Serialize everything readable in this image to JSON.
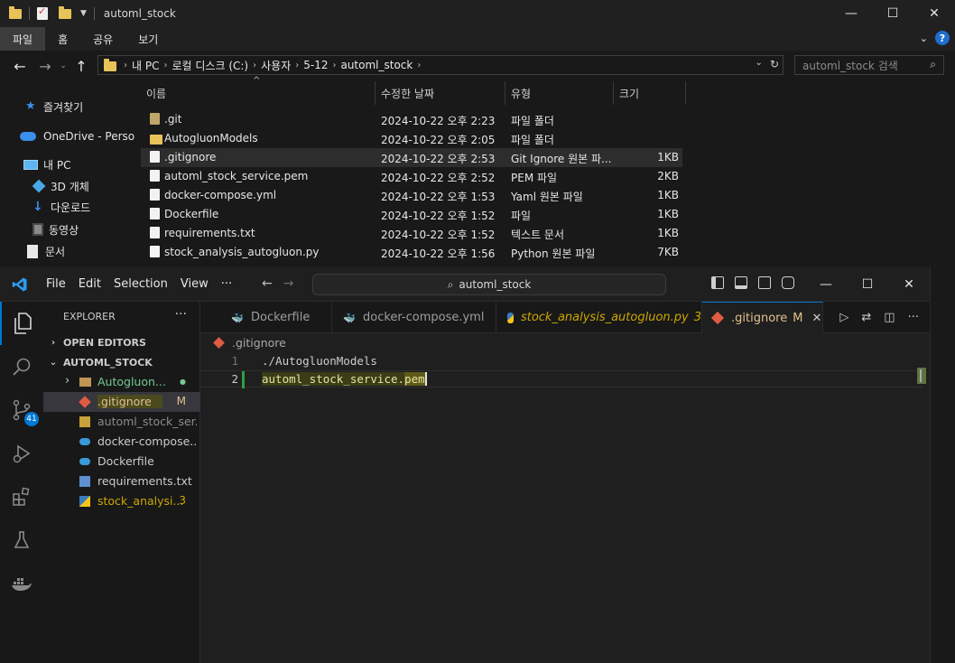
{
  "explorer": {
    "title": "automl_stock",
    "ribbon_tabs": [
      "파일",
      "홈",
      "공유",
      "보기"
    ],
    "address": [
      "내 PC",
      "로컬 디스크 (C:)",
      "사용자",
      "5-12",
      "automl_stock"
    ],
    "search_placeholder": "automl_stock 검색",
    "nav_items": [
      {
        "label": "즐겨찾기",
        "icon": "star-icon"
      },
      {
        "label": "OneDrive - Perso",
        "icon": "cloud-icon"
      },
      {
        "label": "내 PC",
        "icon": "pc-icon"
      },
      {
        "label": "3D 개체",
        "icon": "cube-icon"
      },
      {
        "label": "다운로드",
        "icon": "download-icon"
      },
      {
        "label": "동영상",
        "icon": "video-icon"
      },
      {
        "label": "문서",
        "icon": "document-icon"
      }
    ],
    "columns": [
      "이름",
      "수정한 날짜",
      "유형",
      "크기"
    ],
    "files": [
      {
        "name": ".git",
        "date": "2024-10-22 오후 2:23",
        "type": "파일 폴더",
        "size": "",
        "kind": "git"
      },
      {
        "name": "AutogluonModels",
        "date": "2024-10-22 오후 2:05",
        "type": "파일 폴더",
        "size": "",
        "kind": "folder"
      },
      {
        "name": ".gitignore",
        "date": "2024-10-22 오후 2:53",
        "type": "Git Ignore 원본 파...",
        "size": "1KB",
        "kind": "file"
      },
      {
        "name": "automl_stock_service.pem",
        "date": "2024-10-22 오후 2:52",
        "type": "PEM 파일",
        "size": "2KB",
        "kind": "file"
      },
      {
        "name": "docker-compose.yml",
        "date": "2024-10-22 오후 1:53",
        "type": "Yaml 원본 파일",
        "size": "1KB",
        "kind": "file"
      },
      {
        "name": "Dockerfile",
        "date": "2024-10-22 오후 1:52",
        "type": "파일",
        "size": "1KB",
        "kind": "file"
      },
      {
        "name": "requirements.txt",
        "date": "2024-10-22 오후 1:52",
        "type": "텍스트 문서",
        "size": "1KB",
        "kind": "file"
      },
      {
        "name": "stock_analysis_autogluon.py",
        "date": "2024-10-22 오후 1:56",
        "type": "Python 원본 파일",
        "size": "7KB",
        "kind": "file"
      }
    ]
  },
  "vscode": {
    "menu": [
      "File",
      "Edit",
      "Selection",
      "View",
      "···"
    ],
    "command_center": "automl_stock",
    "activity_badge": "41",
    "explorer_title": "EXPLORER",
    "sections": {
      "open_editors": "OPEN EDITORS",
      "workspace": "AUTOML_STOCK"
    },
    "tree": [
      {
        "label": "Autogluon...",
        "status": "●",
        "color": "#73c991",
        "icon": "folder-icon"
      },
      {
        "label": ".gitignore",
        "status": "M",
        "color": "#e2c08d",
        "icon": "git-icon"
      },
      {
        "label": "automl_stock_ser...",
        "status": "",
        "color": "#8c8c8c",
        "icon": "certificate-icon"
      },
      {
        "label": "docker-compose....",
        "status": "",
        "color": "#cccccc",
        "icon": "docker-icon"
      },
      {
        "label": "Dockerfile",
        "status": "",
        "color": "#cccccc",
        "icon": "docker-icon"
      },
      {
        "label": "requirements.txt",
        "status": "",
        "color": "#cccccc",
        "icon": "pip-icon"
      },
      {
        "label": "stock_analysi...",
        "status": "3",
        "color": "#cca700",
        "icon": "python-icon"
      }
    ],
    "tabs": [
      {
        "label": "Dockerfile",
        "badge": "",
        "icon": "docker-icon"
      },
      {
        "label": "docker-compose.yml",
        "badge": "",
        "icon": "docker-icon"
      },
      {
        "label": "stock_analysis_autogluon.py",
        "badge": "3",
        "icon": "python-icon"
      },
      {
        "label": ".gitignore",
        "badge": "M",
        "icon": "git-icon"
      }
    ],
    "breadcrumb": ".gitignore",
    "lines": [
      {
        "num": "1",
        "text": "./AutogluonModels"
      },
      {
        "num": "2",
        "text_pre": "automl_stock_service.",
        "text_hl": "pem"
      }
    ]
  }
}
